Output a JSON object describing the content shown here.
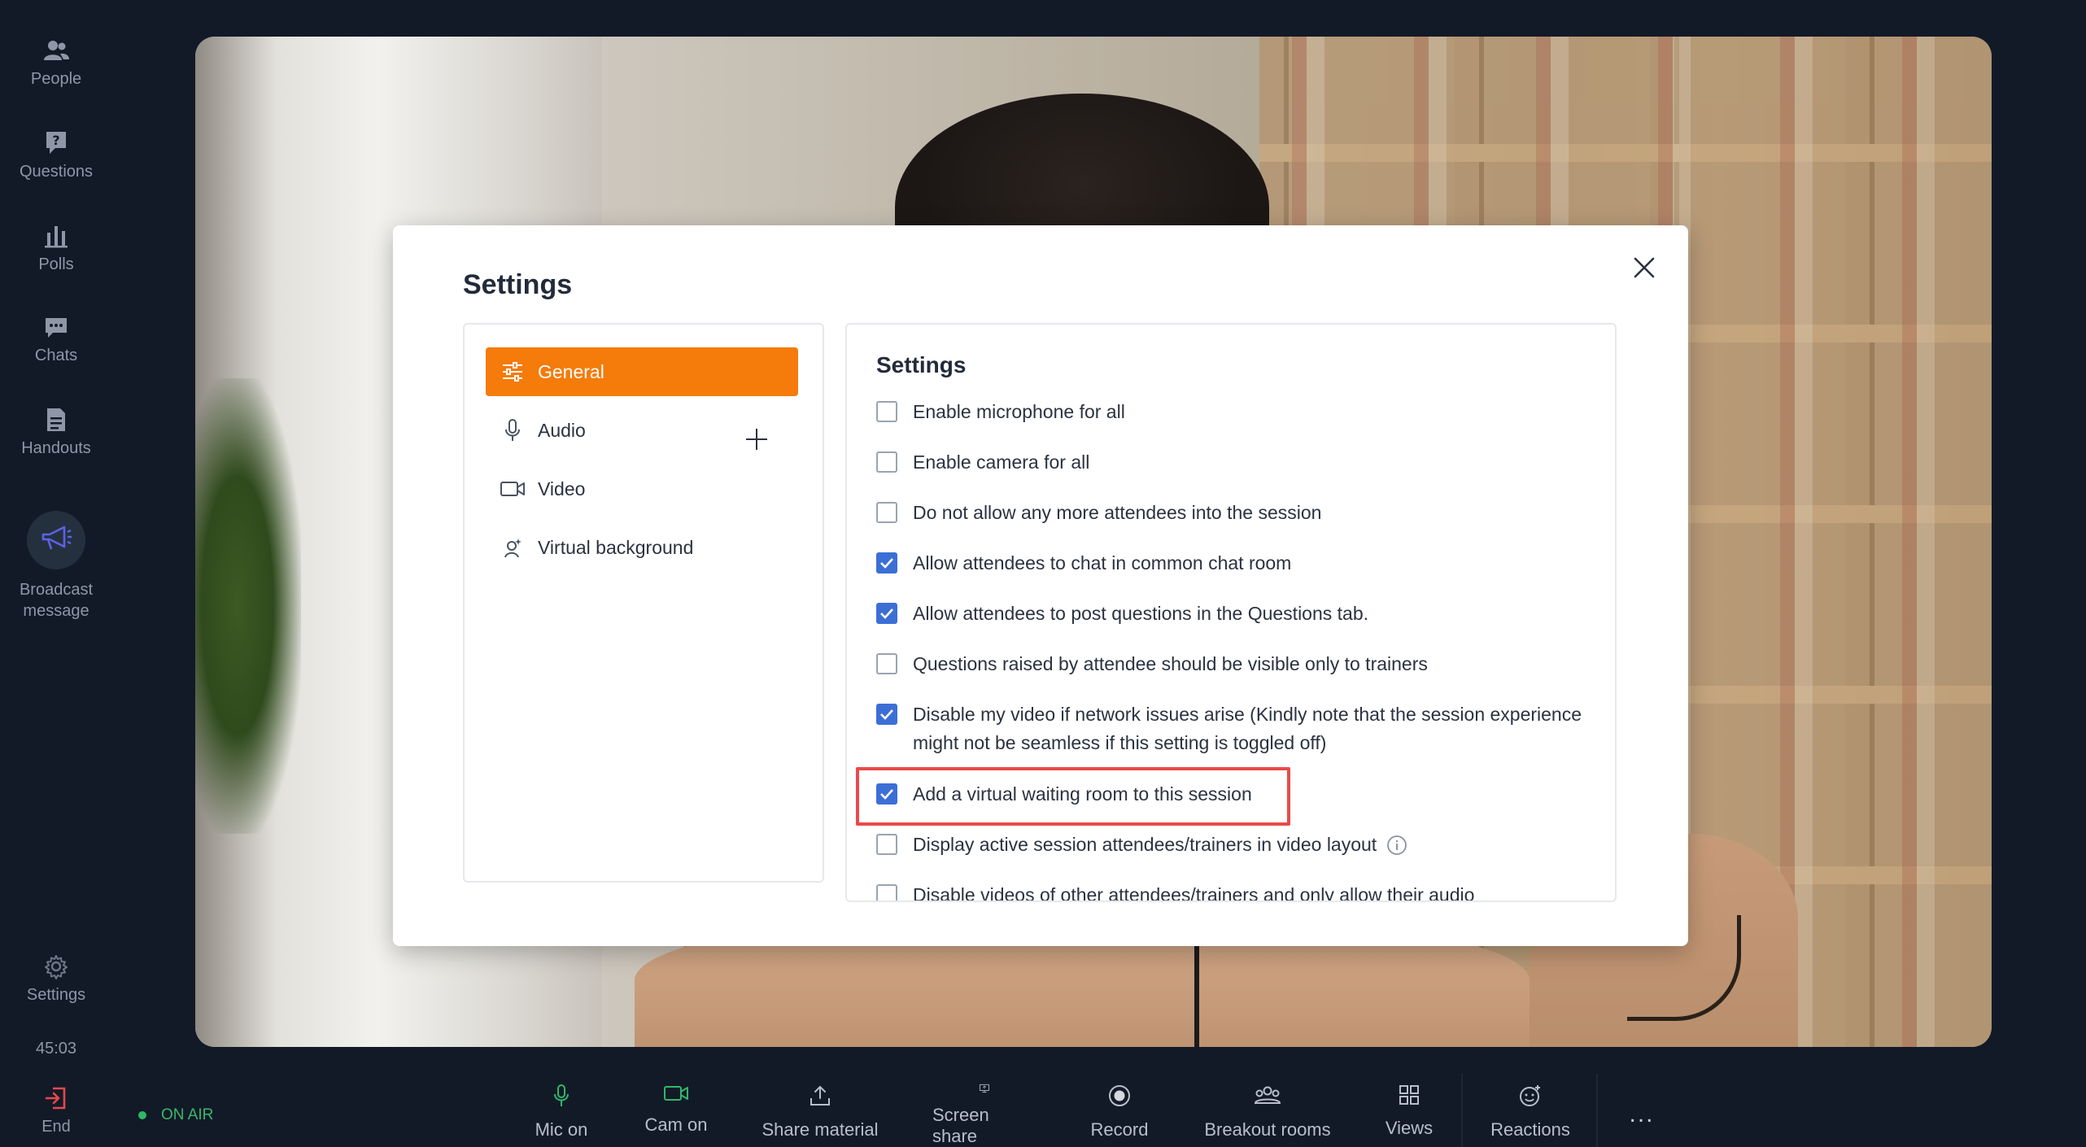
{
  "sidebar": {
    "items": [
      {
        "label": "People",
        "icon": "people-icon"
      },
      {
        "label": "Questions",
        "icon": "question-icon"
      },
      {
        "label": "Polls",
        "icon": "polls-icon"
      },
      {
        "label": "Chats",
        "icon": "chat-icon"
      },
      {
        "label": "Handouts",
        "icon": "handout-icon"
      }
    ],
    "broadcast": {
      "label": "Broadcast\nmessage",
      "icon": "megaphone-icon",
      "icon_color": "#5b63e6"
    },
    "settings_label": "Settings",
    "timer": "45:03",
    "end_label": "End",
    "end_color": "#e5484d"
  },
  "modal": {
    "title": "Settings",
    "nav": [
      {
        "label": "General",
        "icon": "sliders-icon",
        "active": true
      },
      {
        "label": "Audio",
        "icon": "microphone-icon",
        "active": false
      },
      {
        "label": "Video",
        "icon": "video-camera-icon",
        "active": false
      },
      {
        "label": "Virtual background",
        "icon": "virtual-background-icon",
        "active": false
      }
    ],
    "panel_title": "Settings",
    "options": [
      {
        "label": "Enable microphone for all",
        "checked": false
      },
      {
        "label": "Enable camera for all",
        "checked": false
      },
      {
        "label": "Do not allow any more attendees into the session",
        "checked": false
      },
      {
        "label": "Allow attendees to chat in common chat room",
        "checked": true
      },
      {
        "label": "Allow attendees to post questions in the Questions tab.",
        "checked": true
      },
      {
        "label": "Questions raised by attendee should be visible only to trainers",
        "checked": false
      },
      {
        "label": "Disable my video if network issues arise (Kindly note that the session experience might not be seamless if this setting is toggled off)",
        "checked": true
      },
      {
        "label": "Add a virtual waiting room to this session",
        "checked": true,
        "highlighted": true
      },
      {
        "label": "Display active session attendees/trainers in video layout",
        "checked": false,
        "has_info_icon": true
      },
      {
        "label": "Disable videos of other attendees/trainers and only allow their audio",
        "checked": false
      }
    ],
    "accent_color": "#f57b0a",
    "checkbox_color": "#3c6fd6",
    "highlight_color": "#ea4a4a"
  },
  "status": {
    "on_air": "ON AIR",
    "on_air_color": "#2fb866"
  },
  "toolbar": [
    {
      "label": "Mic on",
      "icon": "microphone-icon",
      "color": "#2fb866"
    },
    {
      "label": "Cam on",
      "icon": "camera-icon",
      "color": "#2fb866"
    },
    {
      "label": "Share material",
      "icon": "share-icon"
    },
    {
      "label": "Screen share",
      "icon": "screen-share-icon"
    },
    {
      "label": "Record",
      "icon": "record-icon"
    },
    {
      "label": "Breakout rooms",
      "icon": "breakout-icon"
    },
    {
      "label": "Views",
      "icon": "grid-icon"
    },
    {
      "label": "Reactions",
      "icon": "reaction-icon"
    }
  ],
  "more_label": "..."
}
